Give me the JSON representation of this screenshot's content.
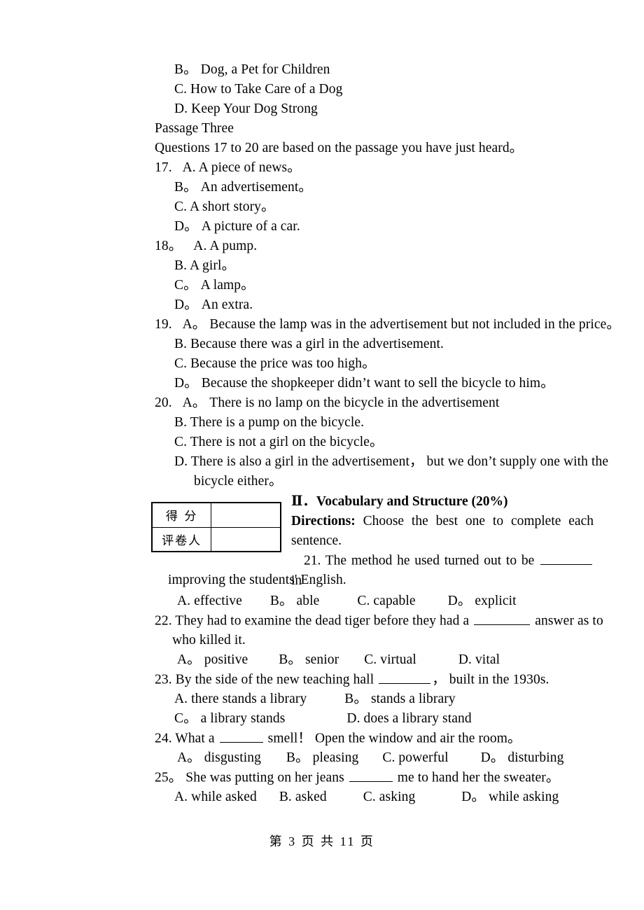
{
  "document": {
    "footer": "第 3 页 共 11 页"
  },
  "listening_tail": {
    "options": [
      "B。   Dog, a Pet for Children",
      "C. How to Take Care of a Dog",
      "D. Keep Your Dog Strong"
    ],
    "passage_label": "Passage Three",
    "instruction": "Questions 17 to 20 are based on the passage you have just heard。"
  },
  "questions_listening": [
    {
      "number": "17.",
      "first_option": "A. A piece of news。",
      "options": [
        "B。   An advertisement。",
        "C. A short story。",
        "D。   A picture of a car."
      ]
    },
    {
      "number": "18。",
      "first_option": "  A. A pump.",
      "options": [
        "B. A girl。",
        "C。   A lamp。",
        "D。   An extra."
      ]
    },
    {
      "number": "19.",
      "first_option": "A。   Because the lamp was in the advertisement but not included in the price。",
      "options": [
        "B. Because there was a girl in the advertisement.",
        "C. Because the price was too high。",
        "D。   Because the shopkeeper didn’t want to sell the bicycle to him。"
      ]
    },
    {
      "number": "20.",
      "first_option": "A。   There is no lamp on the bicycle in the advertisement",
      "options": [
        "B. There is a pump on the bicycle.",
        "C. There is not a girl on the bicycle。"
      ],
      "long_option_part1": "D. There is also a girl in the advertisement，   but we don’t supply one with the",
      "long_option_part2": "bicycle either。"
    }
  ],
  "score_table": {
    "row1_label": "得  分",
    "row1_value": "",
    "row2_label": "评卷人",
    "row2_value": ""
  },
  "section_two": {
    "heading": "Ⅱ．Vocabulary and Structure (20%)",
    "directions_label": "Directions:",
    "directions_text": " Choose the best one to complete each sentence."
  },
  "questions_vocab": [
    {
      "number": "21.",
      "stem_before": " The method he used turned out to be ",
      "stem_after": " in",
      "stem_wrap": "improving the students' English.",
      "options": [
        "A. effective",
        "B。  able",
        "C. capable",
        "D。  explicit"
      ]
    },
    {
      "number": "22.",
      "stem_before": " They had to examine the dead tiger before they had a ",
      "stem_after": " answer as to",
      "stem_wrap": "who killed it.",
      "options": [
        "A。  positive",
        "B。  senior",
        "C. virtual",
        "D. vital"
      ]
    },
    {
      "number": "23.",
      "stem_before": " By the side of the new teaching hall ",
      "stem_after": "，   built in the 1930s.",
      "options": [
        "A. there stands a library",
        "B。   stands a library",
        "C。   a library stands",
        "D. does a library stand"
      ]
    },
    {
      "number": "24.",
      "stem_before": " What a ",
      "stem_after": " smell！  Open the window and air the room。",
      "options": [
        "A。  disgusting",
        "B。  pleasing",
        "C. powerful",
        "D。  disturbing"
      ]
    },
    {
      "number": "25。",
      "stem_before": "  She was putting on her jeans ",
      "stem_after": " me to hand her the sweater。",
      "options": [
        "A. while asked",
        "B. asked",
        "C. asking",
        "D。  while asking"
      ]
    }
  ]
}
